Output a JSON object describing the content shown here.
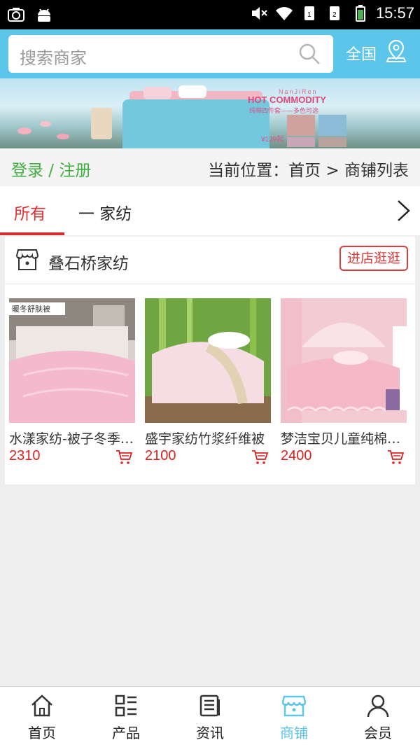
{
  "status_bar": {
    "time": "15:57"
  },
  "header": {
    "search_placeholder": "搜索商家",
    "region_label": "全国"
  },
  "banner": {
    "brand_text": "NanJiRen",
    "headline": "HOT COMMODITY",
    "slogan": "纯棉四件套——多色可选",
    "price_text": "¥139起"
  },
  "breadcrumb": {
    "login_register": "登录 / 注册",
    "location": "当前位置：首页 > 商铺列表"
  },
  "tabs": {
    "all": "所有",
    "category": "一 家纺"
  },
  "store": {
    "name": "叠石桥家纺",
    "enter_button": "进店逛逛",
    "products": [
      {
        "name": "水漾家纺-被子冬季加厚",
        "price": "2310"
      },
      {
        "name": "盛宇家纺竹浆纤维被",
        "price": "2100"
      },
      {
        "name": "梦洁宝贝儿童纯棉套件",
        "price": "2400"
      }
    ]
  },
  "bottom_nav": [
    {
      "label": "首页",
      "icon": "home-icon",
      "active": false
    },
    {
      "label": "产品",
      "icon": "product-grid-icon",
      "active": false
    },
    {
      "label": "资讯",
      "icon": "news-icon",
      "active": false
    },
    {
      "label": "商铺",
      "icon": "store-icon",
      "active": true
    },
    {
      "label": "会员",
      "icon": "member-icon",
      "active": false
    }
  ],
  "colors": {
    "header_bg": "#5bc5ea",
    "accent_red": "#e03131",
    "login_green": "#3fae3f",
    "active_nav": "#5bc5ea"
  }
}
